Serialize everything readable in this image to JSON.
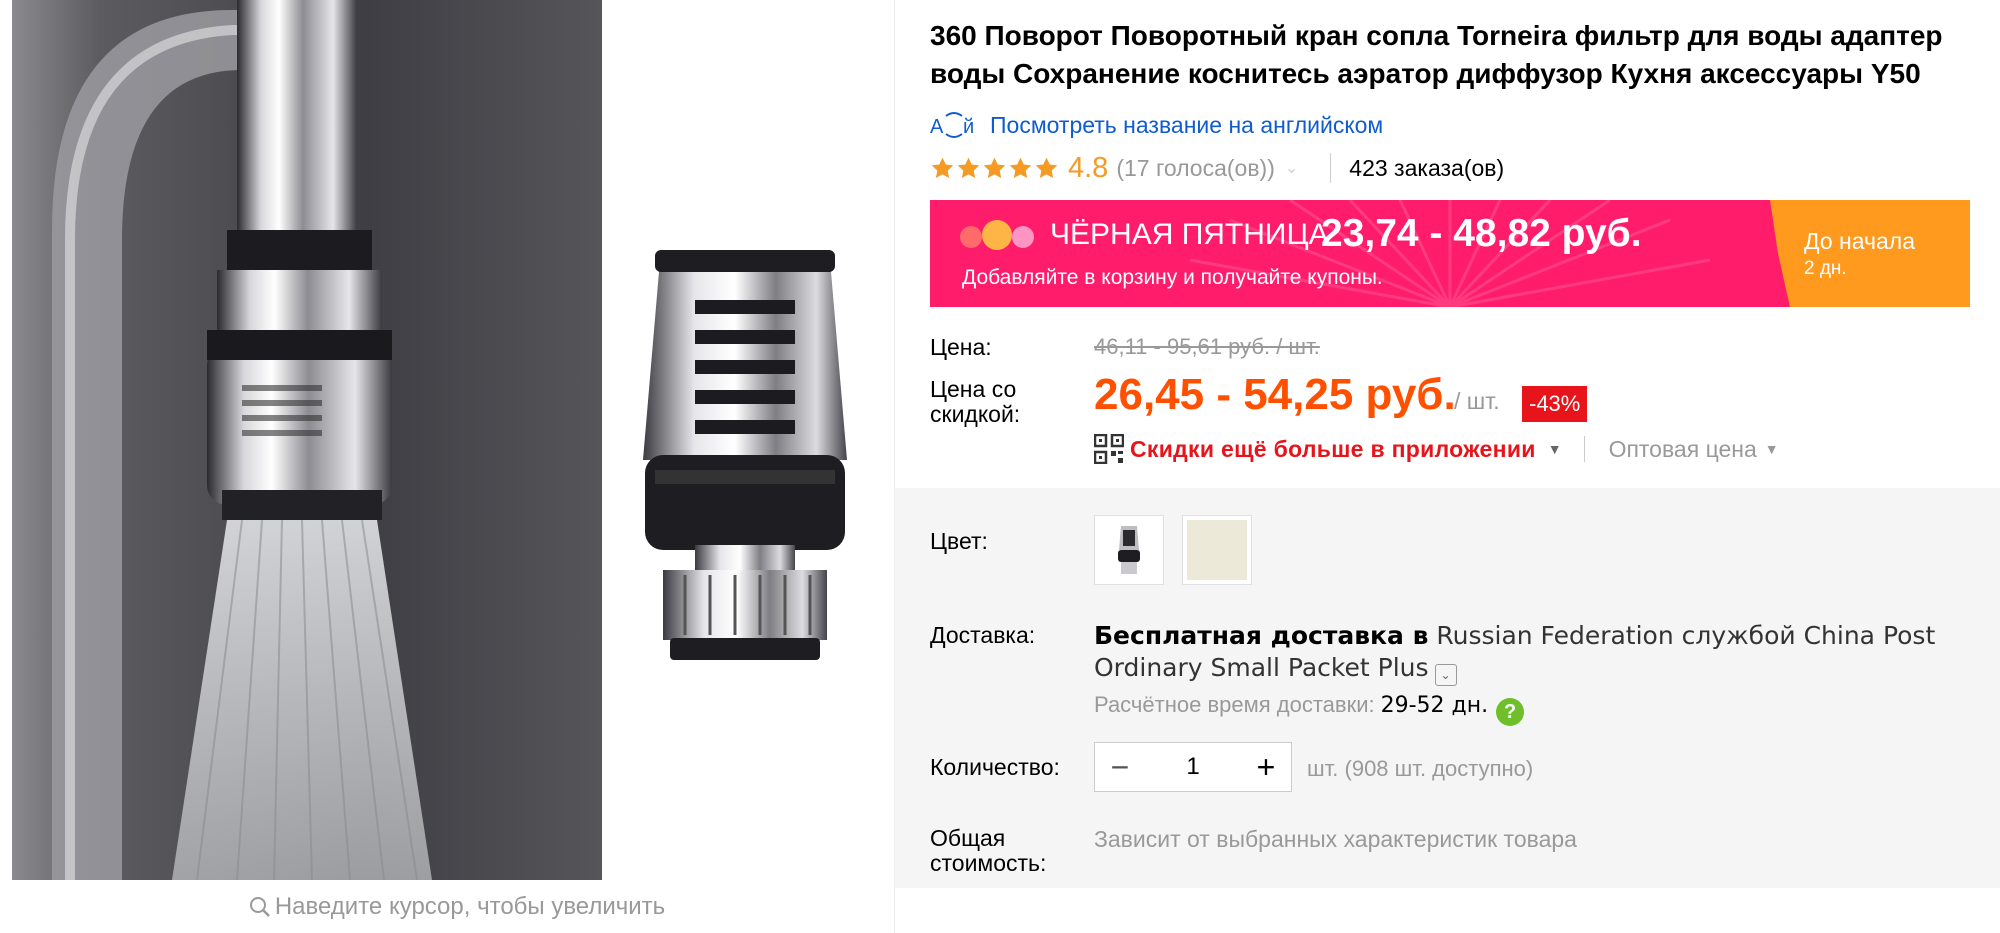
{
  "product": {
    "title": "360 Поворот Поворотный кран сопла Torneira фильтр для воды адаптер воды Сохранение коснитесь аэратор диффузор Кухня аксессуары Y50",
    "translate_link": "Посмотреть название на английском",
    "translate_icon_text": "А й",
    "rating": "4.8",
    "stars": 5,
    "votes": "(17 голоса(ов))",
    "orders": "423 заказа(ов)"
  },
  "gallery": {
    "zoom_hint": "Наведите курсор, чтобы увеличить"
  },
  "promo": {
    "title": "ЧЁРНАЯ ПЯТНИЦА",
    "price": "23,74 - 48,82 руб.",
    "subtitle": "Добавляйте в корзину и получайте купоны.",
    "countdown_label": "До начала",
    "countdown_value": "2 дн.",
    "colors": {
      "banner": "#ff1d6b",
      "countdown": "#ff9a1f"
    }
  },
  "pricing": {
    "price_label": "Цена:",
    "old_price": "46,11 - 95,61 руб. / шт.",
    "sale_label_line1": "Цена со",
    "sale_label_line2": "скидкой:",
    "sale_price": "26,45 - 54,25 руб.",
    "per_unit": "/ шт.",
    "discount": "-43%",
    "app_discount": "Скидки ещё больше в приложении",
    "wholesale": "Оптовая цена",
    "colors": {
      "sale": "#ff5000",
      "discount_badge": "#e8141b"
    }
  },
  "options": {
    "color_label": "Цвет:",
    "swatches": [
      {
        "name": "chrome-aerator",
        "selected": false
      },
      {
        "name": "beige",
        "color": "#ece9d8",
        "selected": false
      }
    ]
  },
  "shipping": {
    "label": "Доставка:",
    "free_text": "Бесплатная доставка в",
    "destination_text": "Russian Federation службой China Post Ordinary Small Packet Plus",
    "estimate_label": "Расчётное время доставки:",
    "estimate_days": "29-52 дн.",
    "help_glyph": "?"
  },
  "quantity": {
    "label": "Количество:",
    "value": "1",
    "minus": "−",
    "plus": "+",
    "available": "шт. (908 шт. доступно)"
  },
  "total": {
    "label_line1": "Общая",
    "label_line2": "стоимость:",
    "note": "Зависит от выбранных характеристик товара"
  }
}
